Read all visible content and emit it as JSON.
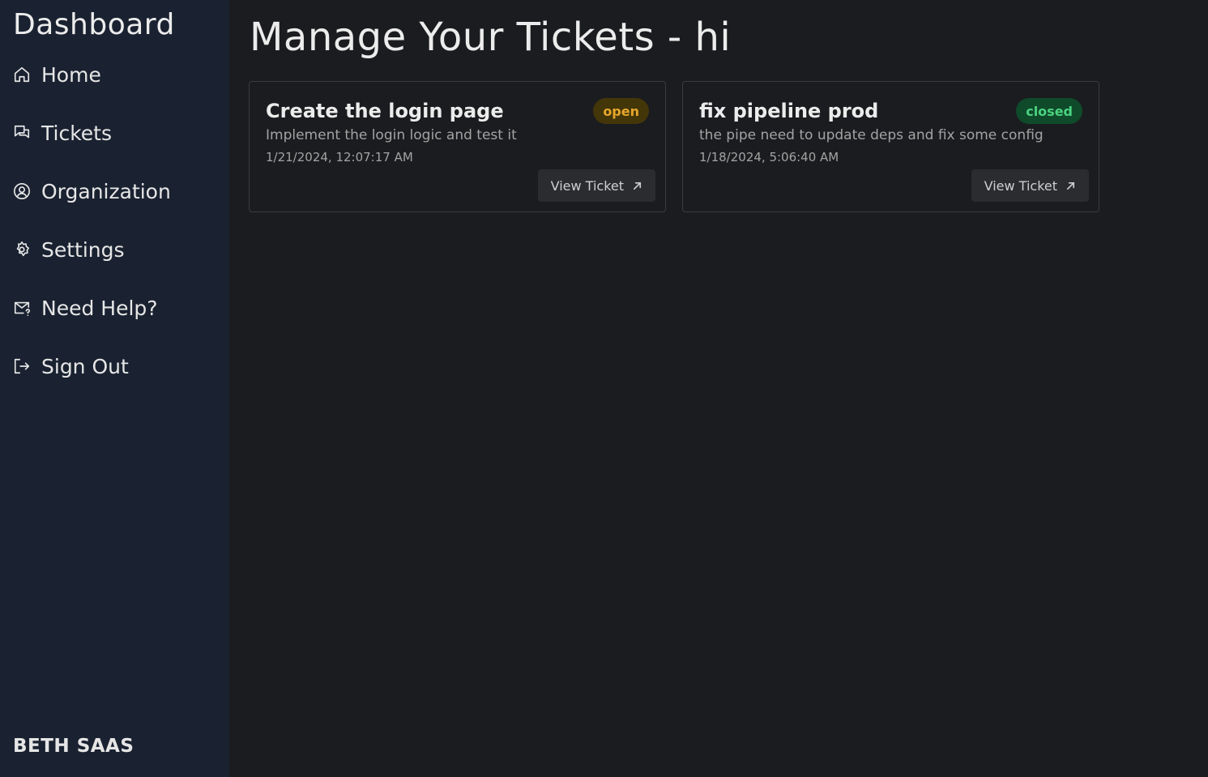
{
  "sidebar": {
    "title": "Dashboard",
    "items": [
      {
        "label": "Home",
        "icon": "home-icon"
      },
      {
        "label": "Tickets",
        "icon": "chat-bubbles-icon"
      },
      {
        "label": "Organization",
        "icon": "user-circle-icon"
      },
      {
        "label": "Settings",
        "icon": "gear-icon"
      },
      {
        "label": "Need Help?",
        "icon": "mail-question-icon"
      },
      {
        "label": "Sign Out",
        "icon": "sign-out-icon"
      }
    ],
    "brand": "BETH SAAS"
  },
  "main": {
    "title": "Manage Your Tickets - hi",
    "tickets": [
      {
        "title": "Create the login page",
        "status": "open",
        "description": "Implement the login logic and test it",
        "date": "1/21/2024, 12:07:17 AM",
        "button_label": "View Ticket"
      },
      {
        "title": "fix pipeline prod",
        "status": "closed",
        "description": "the pipe need to update deps and fix some config",
        "date": "1/18/2024, 5:06:40 AM",
        "button_label": "View Ticket"
      }
    ]
  },
  "colors": {
    "sidebar_bg": "#1a2231",
    "main_bg": "#1b1c1f",
    "open_badge_bg": "#433608",
    "open_badge_text": "#e6a72c",
    "closed_badge_bg": "#0f4a2b",
    "closed_badge_text": "#4bd37f"
  }
}
